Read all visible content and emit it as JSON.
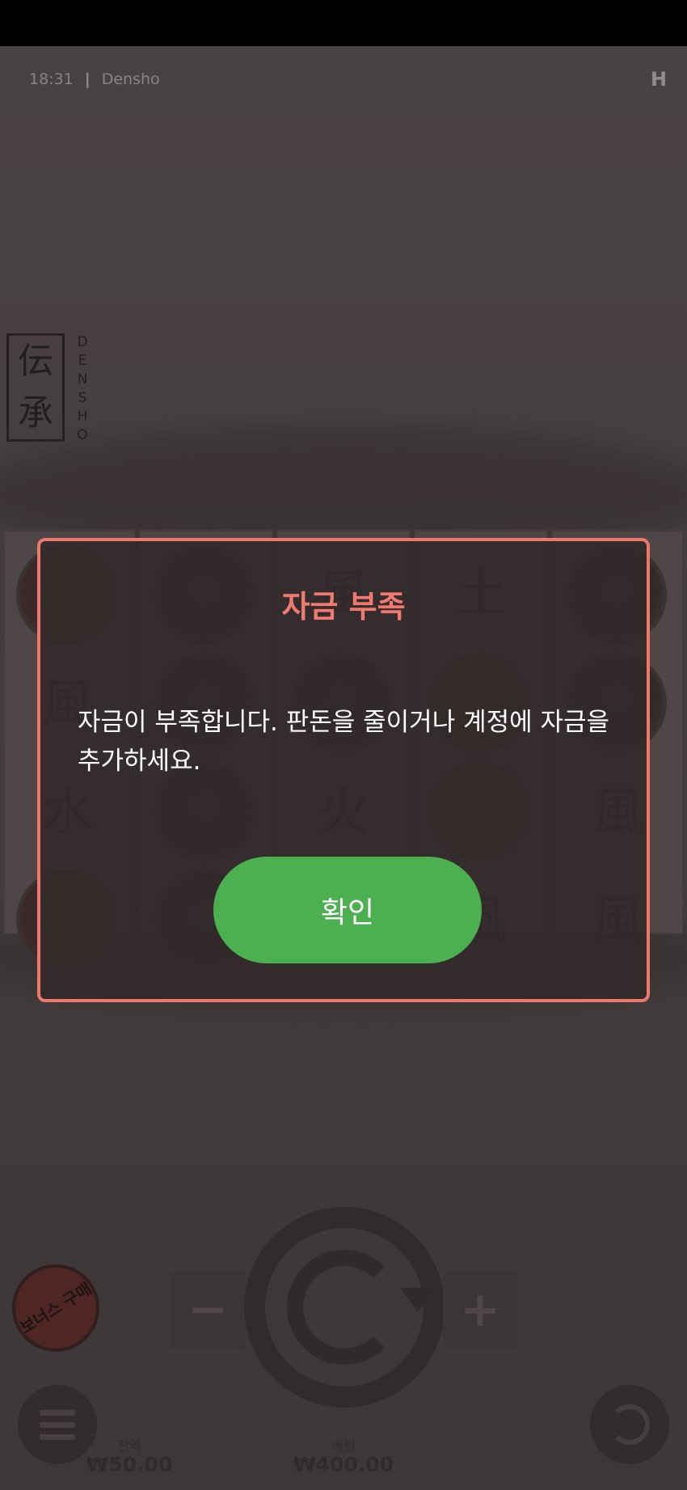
{
  "game": {
    "time": "18:31",
    "separator": "|",
    "name": "Densho",
    "provider_logo": "H",
    "logo_kanji": [
      "伝",
      "承"
    ],
    "logo_letters": [
      "D",
      "E",
      "N",
      "S",
      "H",
      "O"
    ]
  },
  "reels": {
    "kanji_symbols": [
      "風",
      "土",
      "水",
      "火",
      "風",
      "風",
      "風",
      "火",
      "風"
    ]
  },
  "dialog": {
    "title": "자금 부족",
    "message": "자금이 부족합니다. 판돈을 줄이거나 계정에 자금을 추가하세요.",
    "confirm_label": "확인"
  },
  "controls": {
    "bonus_buy_label": "보너스 구매",
    "minus_label": "−",
    "plus_label": "+"
  },
  "stats": {
    "balance_label": "잔액",
    "balance_value": "₩50.00",
    "bet_label": "베팅",
    "bet_value": "₩400.00"
  },
  "colors": {
    "modal_border": "#ef786d",
    "modal_title": "#f07a6f",
    "confirm_button": "#4caf50"
  }
}
